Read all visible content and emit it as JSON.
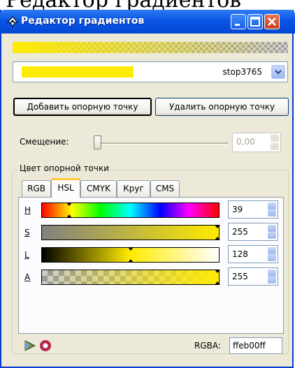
{
  "heading_fragment": "Редактор градиентов",
  "window": {
    "title": "Редактор градиентов",
    "buttons": {
      "minimize": "minimize-icon",
      "maximize": "maximize-icon",
      "close": "close-icon"
    }
  },
  "gradient": {
    "stop_name": "stop3765",
    "stop_color": "#ffeb00"
  },
  "buttons": {
    "add_stop": "Добавить опорную точку",
    "delete_stop": "Удалить опорную точку"
  },
  "offset": {
    "label": "Смещение:",
    "value": "0,00",
    "slider_fraction": 0.0
  },
  "stop_color_group": {
    "title": "Цвет опорной точки",
    "tabs": [
      "RGB",
      "HSL",
      "CMYK",
      "Круг",
      "CMS"
    ],
    "active_tab": "HSL",
    "channels": [
      {
        "label": "H",
        "value": "39"
      },
      {
        "label": "S",
        "value": "255"
      },
      {
        "label": "L",
        "value": "128"
      },
      {
        "label": "A",
        "value": "255"
      }
    ]
  },
  "rgba": {
    "label": "RGBA:",
    "value": "ffeb00ff"
  },
  "icons": {
    "title": "inkscape-icon",
    "bottom_left": [
      "color-picker-icon",
      "color-managed-icon"
    ]
  }
}
